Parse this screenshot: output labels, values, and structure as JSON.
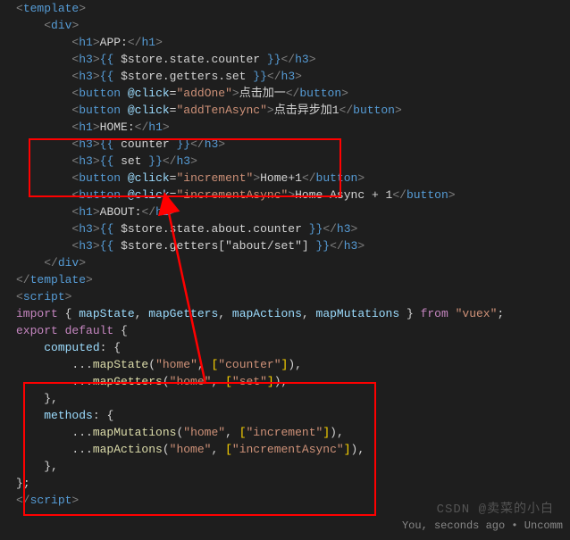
{
  "code": {
    "lines": [
      {
        "indent": 0,
        "parts": [
          {
            "c": "tag",
            "t": "<"
          },
          {
            "c": "elem",
            "t": "template"
          },
          {
            "c": "tag",
            "t": ">"
          }
        ]
      },
      {
        "indent": 2,
        "parts": [
          {
            "c": "tag",
            "t": "<"
          },
          {
            "c": "elem",
            "t": "div"
          },
          {
            "c": "tag",
            "t": ">"
          }
        ]
      },
      {
        "indent": 4,
        "parts": [
          {
            "c": "tag",
            "t": "<"
          },
          {
            "c": "elem",
            "t": "h1"
          },
          {
            "c": "tag",
            "t": ">"
          },
          {
            "c": "text",
            "t": "APP:"
          },
          {
            "c": "tag",
            "t": "</"
          },
          {
            "c": "elem",
            "t": "h1"
          },
          {
            "c": "tag",
            "t": ">"
          }
        ]
      },
      {
        "indent": 4,
        "parts": [
          {
            "c": "tag",
            "t": "<"
          },
          {
            "c": "elem",
            "t": "h3"
          },
          {
            "c": "tag",
            "t": ">"
          },
          {
            "c": "delim",
            "t": "{{ "
          },
          {
            "c": "text",
            "t": "$store.state.counter"
          },
          {
            "c": "delim",
            "t": " }}"
          },
          {
            "c": "tag",
            "t": "</"
          },
          {
            "c": "elem",
            "t": "h3"
          },
          {
            "c": "tag",
            "t": ">"
          }
        ]
      },
      {
        "indent": 4,
        "parts": [
          {
            "c": "tag",
            "t": "<"
          },
          {
            "c": "elem",
            "t": "h3"
          },
          {
            "c": "tag",
            "t": ">"
          },
          {
            "c": "delim",
            "t": "{{ "
          },
          {
            "c": "text",
            "t": "$store.getters.set"
          },
          {
            "c": "delim",
            "t": " }}"
          },
          {
            "c": "tag",
            "t": "</"
          },
          {
            "c": "elem",
            "t": "h3"
          },
          {
            "c": "tag",
            "t": ">"
          }
        ]
      },
      {
        "indent": 4,
        "parts": [
          {
            "c": "tag",
            "t": "<"
          },
          {
            "c": "elem",
            "t": "button"
          },
          {
            "c": "text",
            "t": " "
          },
          {
            "c": "attr",
            "t": "@click"
          },
          {
            "c": "text",
            "t": "="
          },
          {
            "c": "str",
            "t": "\"addOne\""
          },
          {
            "c": "tag",
            "t": ">"
          },
          {
            "c": "text",
            "t": "点击加一"
          },
          {
            "c": "tag",
            "t": "</"
          },
          {
            "c": "elem",
            "t": "button"
          },
          {
            "c": "tag",
            "t": ">"
          }
        ]
      },
      {
        "indent": 4,
        "parts": [
          {
            "c": "tag",
            "t": "<"
          },
          {
            "c": "elem",
            "t": "button"
          },
          {
            "c": "text",
            "t": " "
          },
          {
            "c": "attr",
            "t": "@click"
          },
          {
            "c": "text",
            "t": "="
          },
          {
            "c": "str",
            "t": "\"addTenAsync\""
          },
          {
            "c": "tag",
            "t": ">"
          },
          {
            "c": "text",
            "t": "点击异步加1"
          },
          {
            "c": "tag",
            "t": "</"
          },
          {
            "c": "elem",
            "t": "button"
          },
          {
            "c": "tag",
            "t": ">"
          }
        ]
      },
      {
        "indent": 4,
        "parts": [
          {
            "c": "tag",
            "t": "<"
          },
          {
            "c": "elem",
            "t": "h1"
          },
          {
            "c": "tag",
            "t": ">"
          },
          {
            "c": "text",
            "t": "HOME:"
          },
          {
            "c": "tag",
            "t": "</"
          },
          {
            "c": "elem",
            "t": "h1"
          },
          {
            "c": "tag",
            "t": ">"
          }
        ]
      },
      {
        "indent": 4,
        "parts": [
          {
            "c": "tag",
            "t": "<"
          },
          {
            "c": "elem",
            "t": "h3"
          },
          {
            "c": "tag",
            "t": ">"
          },
          {
            "c": "delim",
            "t": "{{ "
          },
          {
            "c": "text",
            "t": "counter"
          },
          {
            "c": "delim",
            "t": " }}"
          },
          {
            "c": "tag",
            "t": "</"
          },
          {
            "c": "elem",
            "t": "h3"
          },
          {
            "c": "tag",
            "t": ">"
          }
        ]
      },
      {
        "indent": 4,
        "parts": [
          {
            "c": "tag",
            "t": "<"
          },
          {
            "c": "elem",
            "t": "h3"
          },
          {
            "c": "tag",
            "t": ">"
          },
          {
            "c": "delim",
            "t": "{{ "
          },
          {
            "c": "text",
            "t": "set"
          },
          {
            "c": "delim",
            "t": " }}"
          },
          {
            "c": "tag",
            "t": "</"
          },
          {
            "c": "elem",
            "t": "h3"
          },
          {
            "c": "tag",
            "t": ">"
          }
        ]
      },
      {
        "indent": 4,
        "parts": [
          {
            "c": "tag",
            "t": "<"
          },
          {
            "c": "elem",
            "t": "button"
          },
          {
            "c": "text",
            "t": " "
          },
          {
            "c": "attr",
            "t": "@click"
          },
          {
            "c": "text",
            "t": "="
          },
          {
            "c": "str",
            "t": "\"increment\""
          },
          {
            "c": "tag",
            "t": ">"
          },
          {
            "c": "text",
            "t": "Home+1"
          },
          {
            "c": "tag",
            "t": "</"
          },
          {
            "c": "elem",
            "t": "button"
          },
          {
            "c": "tag",
            "t": ">"
          }
        ]
      },
      {
        "indent": 4,
        "parts": [
          {
            "c": "tag",
            "t": "<"
          },
          {
            "c": "elem",
            "t": "button"
          },
          {
            "c": "text",
            "t": " "
          },
          {
            "c": "attr",
            "t": "@click"
          },
          {
            "c": "text",
            "t": "="
          },
          {
            "c": "str",
            "t": "\"incrementAsync\""
          },
          {
            "c": "tag",
            "t": ">"
          },
          {
            "c": "text",
            "t": "Home Async + 1"
          },
          {
            "c": "tag",
            "t": "</"
          },
          {
            "c": "elem",
            "t": "button"
          },
          {
            "c": "tag",
            "t": ">"
          }
        ]
      },
      {
        "indent": 4,
        "parts": [
          {
            "c": "tag",
            "t": "<"
          },
          {
            "c": "elem",
            "t": "h1"
          },
          {
            "c": "tag",
            "t": ">"
          },
          {
            "c": "text",
            "t": "ABOUT:"
          },
          {
            "c": "tag",
            "t": "</"
          },
          {
            "c": "elem",
            "t": "h1"
          },
          {
            "c": "tag",
            "t": ">"
          }
        ]
      },
      {
        "indent": 4,
        "parts": [
          {
            "c": "tag",
            "t": "<"
          },
          {
            "c": "elem",
            "t": "h3"
          },
          {
            "c": "tag",
            "t": ">"
          },
          {
            "c": "delim",
            "t": "{{ "
          },
          {
            "c": "text",
            "t": "$store.state.about.counter"
          },
          {
            "c": "delim",
            "t": " }}"
          },
          {
            "c": "tag",
            "t": "</"
          },
          {
            "c": "elem",
            "t": "h3"
          },
          {
            "c": "tag",
            "t": ">"
          }
        ]
      },
      {
        "indent": 4,
        "parts": [
          {
            "c": "tag",
            "t": "<"
          },
          {
            "c": "elem",
            "t": "h3"
          },
          {
            "c": "tag",
            "t": ">"
          },
          {
            "c": "delim",
            "t": "{{ "
          },
          {
            "c": "text",
            "t": "$store.getters[\"about/set\"]"
          },
          {
            "c": "delim",
            "t": " }}"
          },
          {
            "c": "tag",
            "t": "</"
          },
          {
            "c": "elem",
            "t": "h3"
          },
          {
            "c": "tag",
            "t": ">"
          }
        ]
      },
      {
        "indent": 2,
        "parts": [
          {
            "c": "tag",
            "t": "</"
          },
          {
            "c": "elem",
            "t": "div"
          },
          {
            "c": "tag",
            "t": ">"
          }
        ]
      },
      {
        "indent": 0,
        "parts": [
          {
            "c": "tag",
            "t": "</"
          },
          {
            "c": "elem",
            "t": "template"
          },
          {
            "c": "tag",
            "t": ">"
          }
        ]
      },
      {
        "indent": 0,
        "parts": [
          {
            "c": "text",
            "t": ""
          }
        ]
      },
      {
        "indent": 0,
        "parts": [
          {
            "c": "tag",
            "t": "<"
          },
          {
            "c": "elem",
            "t": "script"
          },
          {
            "c": "tag",
            "t": ">"
          }
        ]
      },
      {
        "indent": 0,
        "parts": [
          {
            "c": "kw-imp",
            "t": "import"
          },
          {
            "c": "text",
            "t": " "
          },
          {
            "c": "brace",
            "t": "{ "
          },
          {
            "c": "ident",
            "t": "mapState"
          },
          {
            "c": "punc",
            "t": ", "
          },
          {
            "c": "ident",
            "t": "mapGetters"
          },
          {
            "c": "punc",
            "t": ", "
          },
          {
            "c": "ident",
            "t": "mapActions"
          },
          {
            "c": "punc",
            "t": ", "
          },
          {
            "c": "ident",
            "t": "mapMutations"
          },
          {
            "c": "brace",
            "t": " }"
          },
          {
            "c": "text",
            "t": " "
          },
          {
            "c": "kw-from",
            "t": "from"
          },
          {
            "c": "text",
            "t": " "
          },
          {
            "c": "str",
            "t": "\"vuex\""
          },
          {
            "c": "punc",
            "t": ";"
          }
        ]
      },
      {
        "indent": 0,
        "parts": [
          {
            "c": "kw-imp",
            "t": "export"
          },
          {
            "c": "text",
            "t": " "
          },
          {
            "c": "kw-imp",
            "t": "default"
          },
          {
            "c": "text",
            "t": " "
          },
          {
            "c": "brace",
            "t": "{"
          }
        ]
      },
      {
        "indent": 2,
        "parts": [
          {
            "c": "ident",
            "t": "computed"
          },
          {
            "c": "punc",
            "t": ": "
          },
          {
            "c": "brace",
            "t": "{"
          }
        ]
      },
      {
        "indent": 4,
        "parts": [
          {
            "c": "punc",
            "t": "..."
          },
          {
            "c": "func",
            "t": "mapState"
          },
          {
            "c": "brace",
            "t": "("
          },
          {
            "c": "str",
            "t": "\"home\""
          },
          {
            "c": "punc",
            "t": ", "
          },
          {
            "c": "bracket",
            "t": "["
          },
          {
            "c": "str",
            "t": "\"counter\""
          },
          {
            "c": "bracket",
            "t": "]"
          },
          {
            "c": "brace",
            "t": ")"
          },
          {
            "c": "punc",
            "t": ","
          }
        ]
      },
      {
        "indent": 4,
        "parts": [
          {
            "c": "punc",
            "t": "..."
          },
          {
            "c": "func",
            "t": "mapGetters"
          },
          {
            "c": "brace",
            "t": "("
          },
          {
            "c": "str",
            "t": "\"home\""
          },
          {
            "c": "punc",
            "t": ", "
          },
          {
            "c": "bracket",
            "t": "["
          },
          {
            "c": "str",
            "t": "\"set\""
          },
          {
            "c": "bracket",
            "t": "]"
          },
          {
            "c": "brace",
            "t": ")"
          },
          {
            "c": "punc",
            "t": ","
          }
        ]
      },
      {
        "indent": 2,
        "parts": [
          {
            "c": "brace",
            "t": "}"
          },
          {
            "c": "punc",
            "t": ","
          }
        ]
      },
      {
        "indent": 2,
        "parts": [
          {
            "c": "ident",
            "t": "methods"
          },
          {
            "c": "punc",
            "t": ": "
          },
          {
            "c": "brace",
            "t": "{"
          }
        ]
      },
      {
        "indent": 4,
        "parts": [
          {
            "c": "punc",
            "t": "..."
          },
          {
            "c": "func",
            "t": "mapMutations"
          },
          {
            "c": "brace",
            "t": "("
          },
          {
            "c": "str",
            "t": "\"home\""
          },
          {
            "c": "punc",
            "t": ", "
          },
          {
            "c": "bracket",
            "t": "["
          },
          {
            "c": "str",
            "t": "\"increment\""
          },
          {
            "c": "bracket",
            "t": "]"
          },
          {
            "c": "brace",
            "t": ")"
          },
          {
            "c": "punc",
            "t": ","
          }
        ]
      },
      {
        "indent": 4,
        "parts": [
          {
            "c": "punc",
            "t": "..."
          },
          {
            "c": "func",
            "t": "mapActions"
          },
          {
            "c": "brace",
            "t": "("
          },
          {
            "c": "str",
            "t": "\"home\""
          },
          {
            "c": "punc",
            "t": ", "
          },
          {
            "c": "bracket",
            "t": "["
          },
          {
            "c": "str",
            "t": "\"incrementAsync\""
          },
          {
            "c": "bracket",
            "t": "]"
          },
          {
            "c": "brace",
            "t": ")"
          },
          {
            "c": "punc",
            "t": ","
          }
        ]
      },
      {
        "indent": 2,
        "parts": [
          {
            "c": "brace",
            "t": "}"
          },
          {
            "c": "punc",
            "t": ","
          }
        ]
      },
      {
        "indent": 0,
        "parts": [
          {
            "c": "brace",
            "t": "}"
          },
          {
            "c": "punc",
            "t": ";"
          }
        ]
      },
      {
        "indent": 0,
        "parts": [
          {
            "c": "tag",
            "t": "</"
          },
          {
            "c": "elem",
            "t": "script"
          },
          {
            "c": "tag",
            "t": ">"
          }
        ]
      }
    ]
  },
  "lens": {
    "text": "You, seconds ago • Uncomm"
  },
  "watermark": "CSDN @卖菜的小白"
}
